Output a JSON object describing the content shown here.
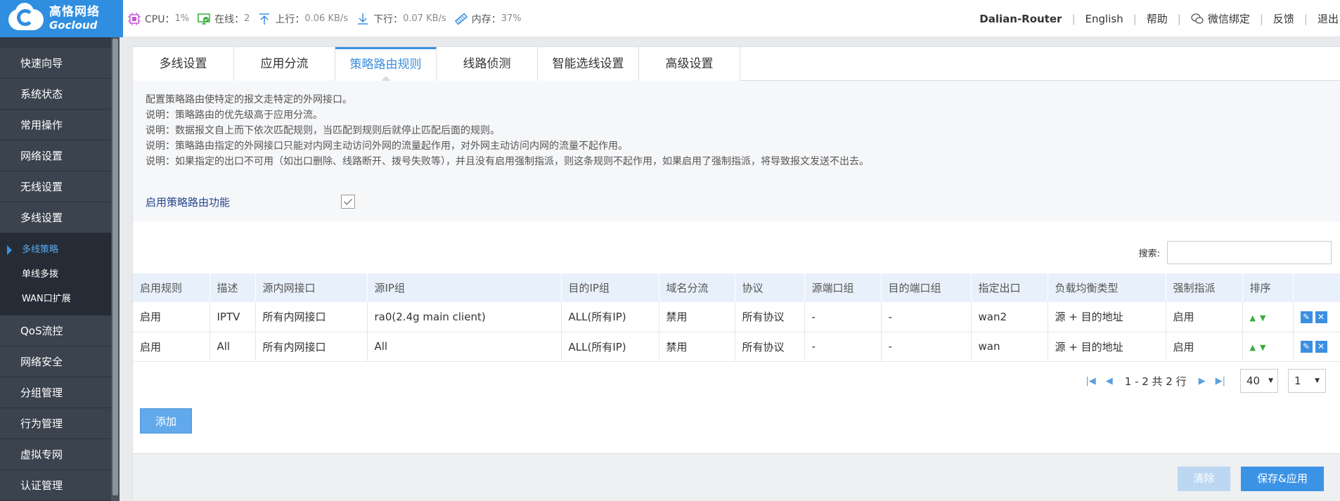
{
  "brand": {
    "cn": "高恪网络",
    "en": "Gocloud"
  },
  "stats": {
    "cpu_label": "CPU：",
    "cpu_value": "1%",
    "online_label": "在线：",
    "online_value": "2",
    "up_label": "上行：",
    "up_value": "0.06 KB/s",
    "down_label": "下行：",
    "down_value": "0.07 KB/s",
    "mem_label": "内存：",
    "mem_value": "37%"
  },
  "top": {
    "router": "Dalian-Router",
    "lang": "English",
    "help": "帮助",
    "wechat": "微信绑定",
    "feedback": "反馈",
    "logout": "退出"
  },
  "sidebar": {
    "items_top": [
      "快速向导",
      "系统状态",
      "常用操作",
      "网络设置",
      "无线设置",
      "多线设置"
    ],
    "sub_items": [
      "多线策略",
      "单线多拨",
      "WAN口扩展"
    ],
    "items_bottom": [
      "QoS流控",
      "网络安全",
      "分组管理",
      "行为管理",
      "虚拟专网",
      "认证管理"
    ]
  },
  "tabs": [
    "多线设置",
    "应用分流",
    "策略路由规则",
    "线路侦测",
    "智能选线设置",
    "高级设置"
  ],
  "desc": [
    "配置策略路由使特定的报文走特定的外网接口。",
    "说明：策略路由的优先级高于应用分流。",
    "说明：数据报文自上而下依次匹配规则，当匹配到规则后就停止匹配后面的规则。",
    "说明：策略路由指定的外网接口只能对内网主动访问外网的流量起作用，对外网主动访问内网的流量不起作用。",
    "说明：如果指定的出口不可用（如出口删除、线路断开、拨号失败等），并且没有启用强制指派，则这条规则不起作用，如果启用了强制指派，将导致报文发送不出去。"
  ],
  "enable_label": "启用策略路由功能",
  "search_label": "搜索:",
  "table": {
    "headers": [
      "启用规则",
      "描述",
      "源内网接口",
      "源IP组",
      "目的IP组",
      "域名分流",
      "协议",
      "源端口组",
      "目的端口组",
      "指定出口",
      "负载均衡类型",
      "强制指派",
      "排序",
      ""
    ],
    "rows": [
      [
        "启用",
        "IPTV",
        "所有内网接口",
        "ra0(2.4g main client)",
        "ALL(所有IP)",
        "禁用",
        "所有协议",
        "-",
        "-",
        "wan2",
        "源 + 目的地址",
        "启用"
      ],
      [
        "启用",
        "All",
        "所有内网接口",
        "All",
        "ALL(所有IP)",
        "禁用",
        "所有协议",
        "-",
        "-",
        "wan",
        "源 + 目的地址",
        "启用"
      ]
    ]
  },
  "pager": {
    "text": "1 - 2 共 2 行",
    "per_page": "40",
    "page": "1"
  },
  "buttons": {
    "add": "添加",
    "clear": "清除",
    "save": "保存&应用"
  },
  "colors": {
    "accent": "#3b8fe0",
    "sidebar": "#323b46"
  }
}
